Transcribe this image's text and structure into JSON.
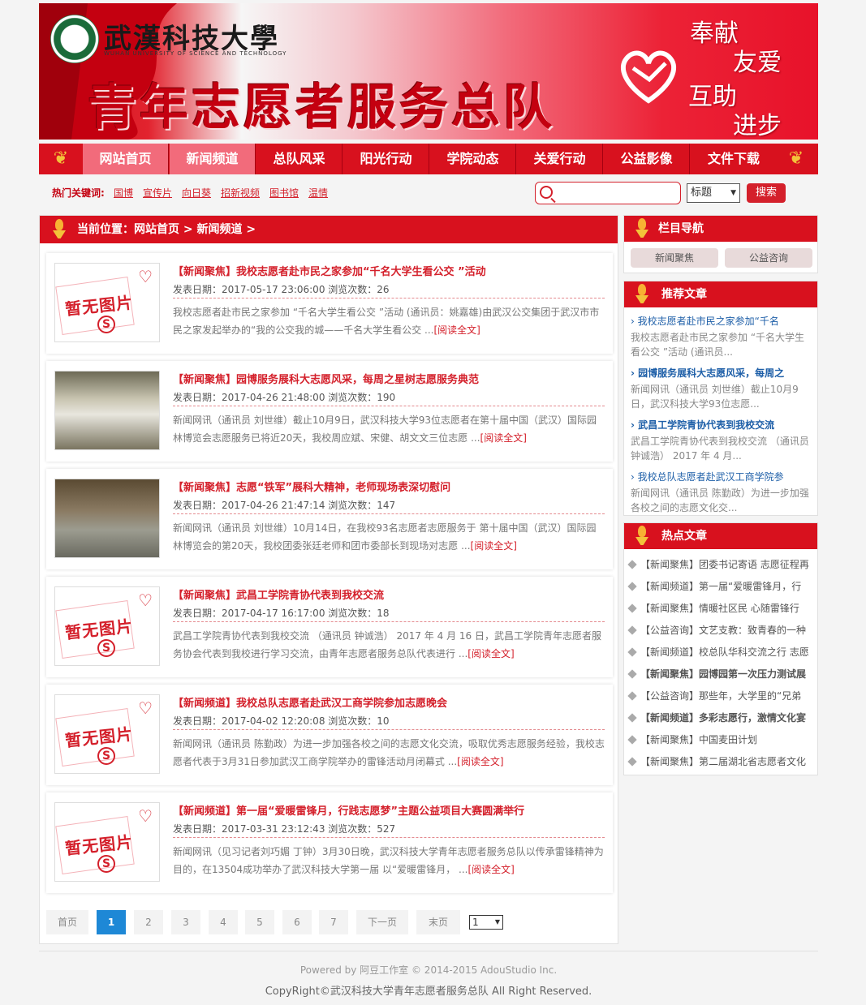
{
  "banner": {
    "school_name": "武漢科技大學",
    "school_en": "WUHAN UNIVERSITY OF SCIENCE AND TECHNOLOGY",
    "title": "青年志愿者服务总队",
    "slogans": [
      "奉献",
      "友爱",
      "互助",
      "进步"
    ]
  },
  "nav": [
    "网站首页",
    "新闻频道",
    "总队风采",
    "阳光行动",
    "学院动态",
    "关爱行动",
    "公益影像",
    "文件下载"
  ],
  "keywords": {
    "label": "热门关键词:",
    "items": [
      "国博",
      "宣传片",
      "向日葵",
      "招新视频",
      "图书馆",
      "温情"
    ]
  },
  "search": {
    "type": "标题",
    "button": "搜索"
  },
  "breadcrumb": "当前位置：网站首页 > 新闻频道 >",
  "articles": [
    {
      "title": "【新闻聚焦】我校志愿者赴市民之家参加“千名大学生看公交 ”活动",
      "meta": "发表日期：2017-05-17 23:06:00 浏览次数：26",
      "desc": "我校志愿者赴市民之家参加 “千名大学生看公交 ”活动 (通讯员：姚嘉雄)由武汉公交集团于武汉市市民之家发起举办的“我的公交我的城——千名大学生看公交 ...",
      "more": "[阅读全文]"
    },
    {
      "title": "【新闻聚焦】园博服务展科大志愿风采，每周之星树志愿服务典范",
      "meta": "发表日期：2017-04-26 21:48:00 浏览次数：190",
      "desc": "新闻网讯（通讯员 刘世维）截止10月9日，武汉科技大学93位志愿者在第十届中国（武汉）国际园林博览会志愿服务已将近20天，我校周应斌、宋健、胡文文三位志愿 ...",
      "more": "[阅读全文]"
    },
    {
      "title": "【新闻聚焦】志愿“铁军”展科大精神，老师现场表深切慰问",
      "meta": "发表日期：2017-04-26 21:47:14 浏览次数：147",
      "desc": "新闻网讯（通讯员 刘世维）10月14日，在我校93名志愿者志愿服务于 第十届中国（武汉）国际园林博览会的第20天，我校团委张廷老师和团市委部长到现场对志愿 ...",
      "more": "[阅读全文]"
    },
    {
      "title": "【新闻聚焦】武昌工学院青协代表到我校交流",
      "meta": "发表日期：2017-04-17 16:17:00 浏览次数：18",
      "desc": "武昌工学院青协代表到我校交流 （通讯员 钟诚浩） 2017 年 4 月 16 日，武昌工学院青年志愿者服务协会代表到我校进行学习交流，由青年志愿者服务总队代表进行 ...",
      "more": "[阅读全文]"
    },
    {
      "title": "【新闻频道】我校总队志愿者赴武汉工商学院参加志愿晚会",
      "meta": "发表日期：2017-04-02 12:20:08 浏览次数：10",
      "desc": "新闻网讯（通讯员 陈勤政）为进一步加强各校之间的志愿文化交流，吸取优秀志愿服务经验，我校志愿者代表于3月31日参加武汉工商学院举办的雷锋活动月闭幕式 ...",
      "more": "[阅读全文]"
    },
    {
      "title": "【新闻频道】第一届“爱暖雷锋月，行践志愿梦”主题公益项目大赛圆满举行",
      "meta": "发表日期：2017-03-31 23:12:43 浏览次数：527",
      "desc": "新闻网讯（见习记者刘巧媚 丁钟）3月30日晚，武汉科技大学青年志愿者服务总队以传承雷锋精神为目的，在13504成功举办了武汉科技大学第一届 以“爱暖雷锋月， ...",
      "more": "[阅读全文]"
    }
  ],
  "no_image_text": "暂无图片",
  "pager": {
    "first": "首页",
    "pages": [
      "1",
      "2",
      "3",
      "4",
      "5",
      "6",
      "7"
    ],
    "next": "下一页",
    "last": "末页",
    "select": "1"
  },
  "sidebar": {
    "nav_title": "栏目导航",
    "nav_buttons": [
      "新闻聚焦",
      "公益咨询"
    ],
    "rec_title": "推荐文章",
    "rec": [
      {
        "title": "› 我校志愿者赴市民之家参加“千名",
        "desc": "我校志愿者赴市民之家参加 “千名大学生看公交 ”活动 (通讯员..."
      },
      {
        "title": "› 园博服务展科大志愿风采，每周之",
        "desc": "新闻网讯（通讯员 刘世维）截止10月9日，武汉科技大学93位志愿..."
      },
      {
        "title": "› 武昌工学院青协代表到我校交流",
        "desc": "武昌工学院青协代表到我校交流 （通讯员 钟诚浩） 2017 年 4 月..."
      },
      {
        "title": "› 我校总队志愿者赴武汉工商学院参",
        "desc": "新闻网讯（通讯员 陈勤政）为进一步加强各校之间的志愿文化交..."
      }
    ],
    "hot_title": "热点文章",
    "hot": [
      "【新闻聚焦】团委书记寄语 志愿征程再",
      "【新闻频道】第一届“爱暖雷锋月，行",
      "【新闻聚焦】情暖社区民 心随雷锋行",
      "【公益咨询】文艺支教：致青春的一种",
      "【新闻频道】校总队华科交流之行 志愿",
      "【新闻聚焦】园博园第一次压力测试展",
      "【公益咨询】那些年，大学里的“兄弟",
      "【新闻频道】多彩志愿行，激情文化宴",
      "【新闻聚焦】中国麦田计划",
      "【新闻聚焦】第二届湖北省志愿者文化"
    ]
  },
  "footer": {
    "powered": "Powered by 阿豆工作室 © 2014-2015 AdouStudio Inc.",
    "copyright": "CopyRight©武汉科技大学青年志愿者服务总队 All Right Reserved."
  },
  "colors": {
    "brand_red": "#d8111e",
    "pager_active": "#1e88d6"
  }
}
